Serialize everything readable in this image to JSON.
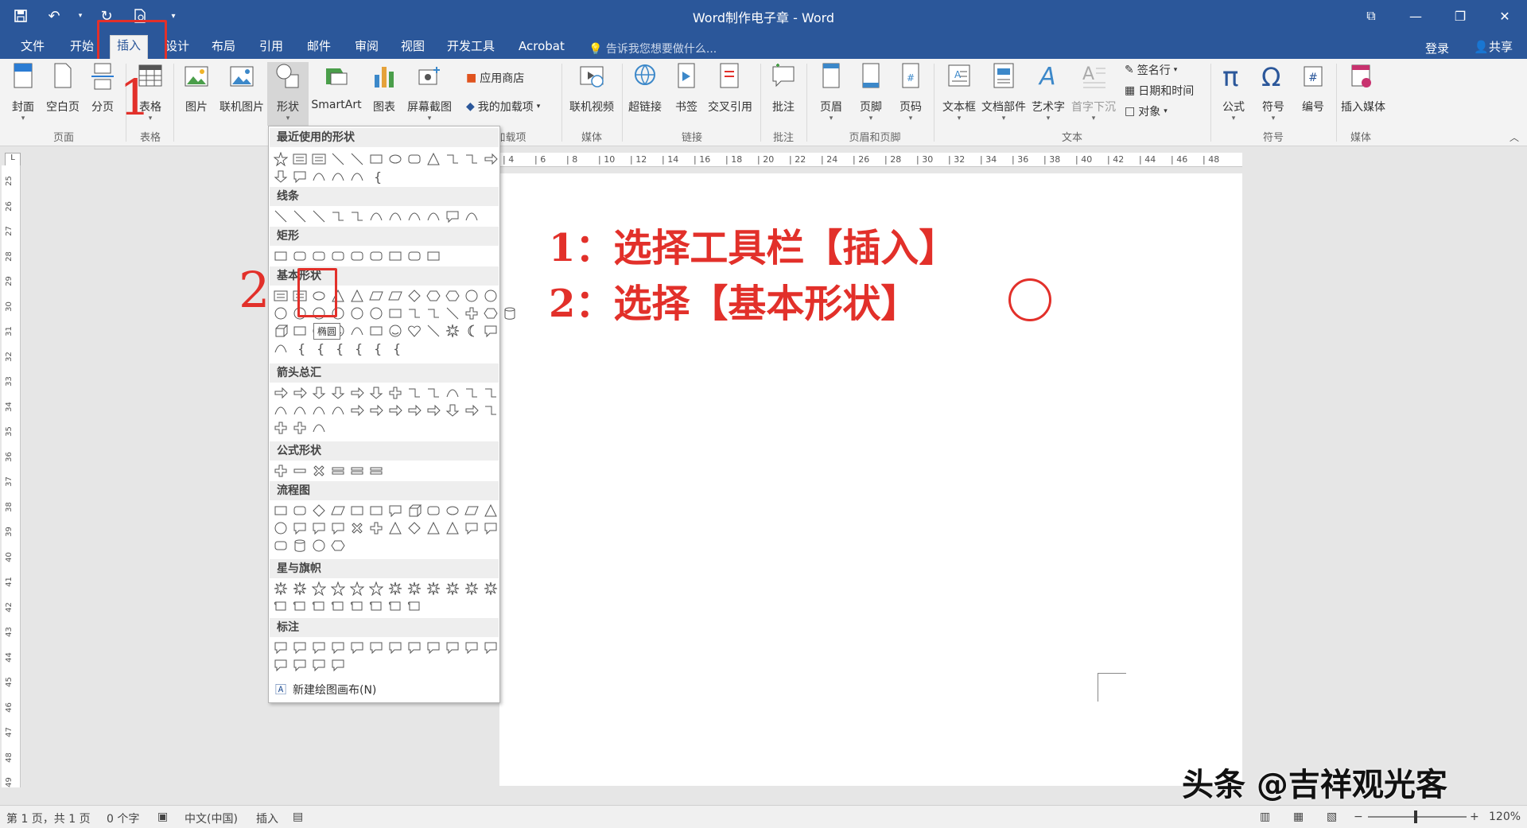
{
  "window": {
    "title": "Word制作电子章 - Word"
  },
  "tabs": [
    {
      "label": "文件"
    },
    {
      "label": "开始"
    },
    {
      "label": "插入"
    },
    {
      "label": "设计"
    },
    {
      "label": "布局"
    },
    {
      "label": "引用"
    },
    {
      "label": "邮件"
    },
    {
      "label": "审阅"
    },
    {
      "label": "视图"
    },
    {
      "label": "开发工具"
    },
    {
      "label": "Acrobat"
    }
  ],
  "tellme": "告诉我您想要做什么...",
  "account": {
    "login": "登录",
    "share": "共享"
  },
  "ribbon": {
    "buttons": {
      "cover": "封面",
      "blank": "空白页",
      "pagebreak": "分页",
      "table": "表格",
      "picture": "图片",
      "online_picture": "联机图片",
      "shapes": "形状",
      "smartart": "SmartArt",
      "chart": "图表",
      "screenshot": "屏幕截图",
      "store": "应用商店",
      "my_addins": "我的加载项",
      "online_video": "联机视频",
      "hyperlink": "超链接",
      "bookmark": "书签",
      "cross_ref": "交叉引用",
      "comment": "批注",
      "header": "页眉",
      "footer": "页脚",
      "page_num": "页码",
      "textbox": "文本框",
      "quickparts": "文档部件",
      "wordart": "艺术字",
      "dropcap": "首字下沉",
      "signature": "签名行",
      "datetime": "日期和时间",
      "object": "对象",
      "equation": "公式",
      "symbol": "符号",
      "number": "编号",
      "insert_media": "插入媒体"
    },
    "groups": {
      "pages": "页面",
      "tables": "表格",
      "addins": "加载项",
      "media": "媒体",
      "links": "链接",
      "comments": "批注",
      "header_footer": "页眉和页脚",
      "text": "文本",
      "symbols": "符号",
      "media2": "媒体"
    }
  },
  "shapes_menu": {
    "sections": {
      "recent": "最近使用的形状",
      "lines": "线条",
      "rect": "矩形",
      "basic": "基本形状",
      "arrows": "箭头总汇",
      "equation": "公式形状",
      "flowchart": "流程图",
      "stars": "星与旗帜",
      "callouts": "标注"
    },
    "tooltip": "椭圆",
    "new_canvas": "新建绘图画布(N)"
  },
  "annotations": {
    "num1": "1",
    "num2": "2",
    "step1": "1：选择工具栏【插入】",
    "step2": "2：选择【基本形状】"
  },
  "ruler": {
    "h_ticks": [
      "4",
      "6",
      "8",
      "10",
      "12",
      "14",
      "16",
      "18",
      "20",
      "22",
      "24",
      "26",
      "28",
      "30",
      "32",
      "34",
      "36",
      "38",
      "40",
      "42",
      "44",
      "46",
      "48"
    ],
    "v_ticks": [
      "25",
      "26",
      "27",
      "28",
      "29",
      "30",
      "31",
      "32",
      "33",
      "34",
      "35",
      "36",
      "37",
      "38",
      "39",
      "40",
      "41",
      "42",
      "43",
      "44",
      "45",
      "46",
      "47",
      "48",
      "49"
    ],
    "corner": "L"
  },
  "statusbar": {
    "page": "第 1 页，共 1 页",
    "words": "0 个字",
    "lang": "中文(中国)",
    "mode": "插入",
    "zoom": "120%"
  },
  "watermark": "头条 @吉祥观光客",
  "colors": {
    "accent": "#2b579a",
    "annotation": "#e2302a"
  }
}
